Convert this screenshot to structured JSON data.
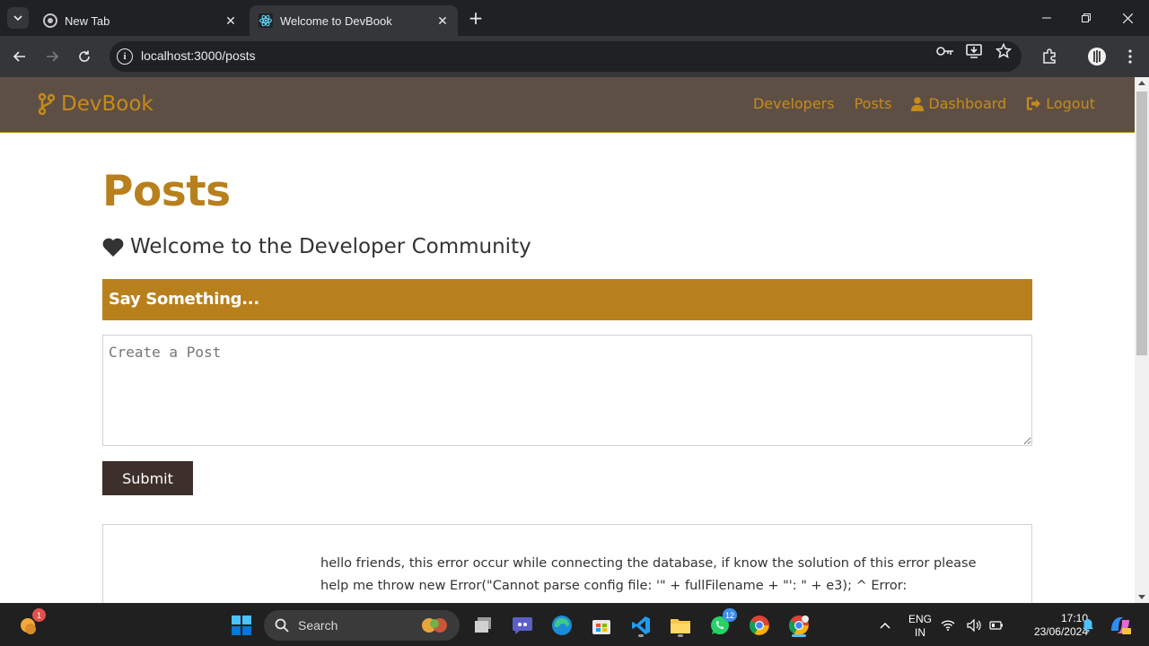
{
  "browser": {
    "tabs": [
      {
        "title": "New Tab",
        "active": false
      },
      {
        "title": "Welcome to DevBook",
        "active": true
      }
    ],
    "url": "localhost:3000/posts"
  },
  "site": {
    "brand": "DevBook",
    "nav": {
      "developers": "Developers",
      "posts": "Posts",
      "dashboard": "Dashboard",
      "logout": "Logout"
    }
  },
  "page": {
    "title": "Posts",
    "lead": "Welcome to the Developer Community",
    "form_header": "Say Something...",
    "textarea_placeholder": "Create a Post",
    "submit_label": "Submit",
    "posts": [
      {
        "text": "hello friends, this error occur while connecting the database, if know the solution of this error please help me throw new Error(\"Cannot parse config file: '\" + fullFilename + \"': \" + e3); ^ Error:"
      }
    ]
  },
  "taskbar": {
    "search_label": "Search",
    "weather_badge": "1",
    "whatsapp_badge": "12",
    "lang_line1": "ENG",
    "lang_line2": "IN",
    "time": "17:10",
    "date": "23/06/2024"
  },
  "colors": {
    "accent": "#b8801d",
    "navbar": "#5e4f45",
    "submit": "#3d302b"
  }
}
